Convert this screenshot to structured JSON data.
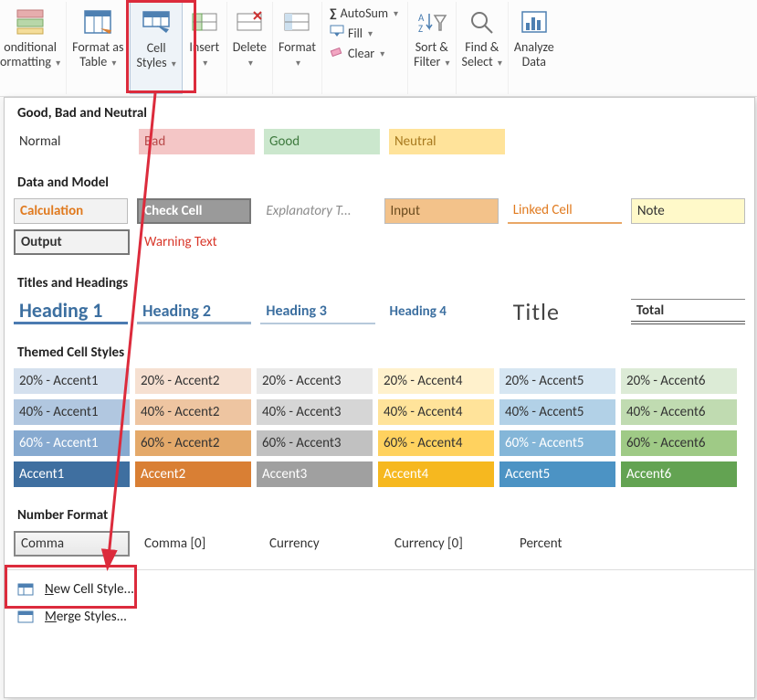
{
  "ribbon": {
    "conditional_formatting": "onditional\normatting",
    "format_as_table": "Format as\nTable",
    "cell_styles": "Cell\nStyles",
    "insert": "Insert",
    "delete": "Delete",
    "format": "Format",
    "autosum": "AutoSum",
    "fill": "Fill",
    "clear": "Clear",
    "sort_filter": "Sort &\nFilter",
    "find_select": "Find &\nSelect",
    "analyze_data": "Analyze\nData"
  },
  "sections": {
    "good_bad_neutral": "Good, Bad and Neutral",
    "data_model": "Data and Model",
    "titles_headings": "Titles and Headings",
    "themed": "Themed Cell Styles",
    "number_format": "Number Format"
  },
  "styles": {
    "row1": [
      "Normal",
      "Bad",
      "Good",
      "Neutral"
    ],
    "row2a": [
      "Calculation",
      "Check Cell",
      "Explanatory T...",
      "Input",
      "Linked Cell",
      "Note"
    ],
    "row2b": [
      "Output",
      "Warning Text"
    ],
    "row3": [
      "Heading 1",
      "Heading 2",
      "Heading 3",
      "Heading 4",
      "Title",
      "Total"
    ],
    "themed": {
      "r20": [
        "20% - Accent1",
        "20% - Accent2",
        "20% - Accent3",
        "20% - Accent4",
        "20% - Accent5",
        "20% - Accent6"
      ],
      "r40": [
        "40% - Accent1",
        "40% - Accent2",
        "40% - Accent3",
        "40% - Accent4",
        "40% - Accent5",
        "40% - Accent6"
      ],
      "r60": [
        "60% - Accent1",
        "60% - Accent2",
        "60% - Accent3",
        "60% - Accent4",
        "60% - Accent5",
        "60% - Accent6"
      ],
      "full": [
        "Accent1",
        "Accent2",
        "Accent3",
        "Accent4",
        "Accent5",
        "Accent6"
      ]
    },
    "number": [
      "Comma",
      "Comma [0]",
      "Currency",
      "Currency [0]",
      "Percent"
    ]
  },
  "menu": {
    "new_cell_style": "New Cell Style...",
    "merge_styles": "Merge Styles..."
  },
  "colors": {
    "bad_bg": "#f4c6c6",
    "bad_fg": "#b84a4a",
    "good_bg": "#cbe7cd",
    "good_fg": "#3e7a3e",
    "neutral_bg": "#ffe39a",
    "neutral_fg": "#a87a1f",
    "calc_fg": "#e07a1f",
    "check_bg": "#8d8d8d",
    "check_fg": "#ffffff",
    "explan_fg": "#8c8c8c",
    "input_bg": "#f3c28a",
    "input_fg": "#6a4b1e",
    "linked_fg": "#e07a1f",
    "note_bg": "#fff9c9",
    "output_fg": "#333",
    "warning_fg": "#d8372a",
    "a1_20": "#d4e0ee",
    "a2_20": "#f6e0d1",
    "a3_20": "#e9e9e9",
    "a4_20": "#fff1cc",
    "a5_20": "#d6e6f2",
    "a6_20": "#dcebd6",
    "a1_40": "#b1c7e0",
    "a2_40": "#eec5a1",
    "a3_40": "#d6d6d6",
    "a4_40": "#ffe39a",
    "a5_40": "#b2d1e7",
    "a6_40": "#c0dbb1",
    "a1_60": "#87aad0",
    "a2_60": "#e4a96a",
    "a3_60": "#c1c1c1",
    "a4_60": "#ffd25f",
    "a5_60": "#84b6d8",
    "a6_60": "#9fca86",
    "a1": "#3f6fa0",
    "a2": "#d97f34",
    "a3": "#a0a0a0",
    "a4": "#f6b81f",
    "a5": "#4c93c4",
    "a6": "#63a352"
  }
}
